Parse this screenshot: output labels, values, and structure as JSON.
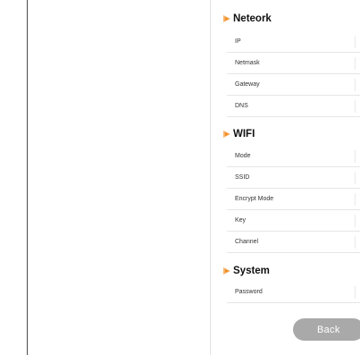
{
  "colors": {
    "accent": "#f28c1c",
    "button_bg": "#a9a9a9",
    "divider": "#e6e6e6"
  },
  "sections": {
    "network": {
      "title": "Neteork",
      "icon": "orange-triangle-icon",
      "rows": [
        "IP",
        "Netmask",
        "Gateway",
        "DNS"
      ]
    },
    "wifi": {
      "title": "WIFI",
      "icon": "orange-triangle-icon",
      "rows": [
        "Mode",
        "SSID",
        "Encrypt Mode",
        "Key",
        "Channel"
      ]
    },
    "system": {
      "title": "System",
      "icon": "orange-triangle-icon",
      "rows": [
        "Password"
      ]
    }
  },
  "buttons": {
    "back": "Back"
  }
}
